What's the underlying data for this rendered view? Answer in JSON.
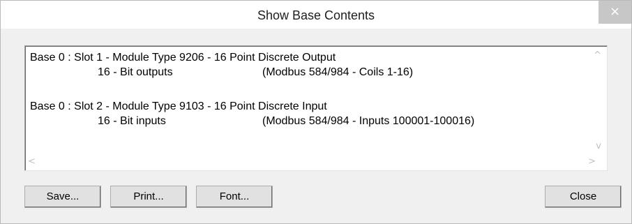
{
  "window": {
    "title": "Show Base Contents",
    "close_glyph": "×"
  },
  "content": {
    "entries": [
      {
        "header": "Base 0 : Slot 1 - Module Type 9206 - 16 Point Discrete Output",
        "detail": "16 - Bit outputs",
        "mapping": "(Modbus 584/984 - Coils 1-16)"
      },
      {
        "header": "Base 0 : Slot 2 - Module Type 9103 - 16 Point Discrete Input",
        "detail": "16 - Bit inputs",
        "mapping": "(Modbus 584/984 - Inputs 100001-100016)"
      }
    ],
    "scroll_up_glyph": "^",
    "scroll_down_glyph": "v",
    "scroll_left_glyph": "<",
    "scroll_right_glyph": ">"
  },
  "buttons": {
    "save": "Save...",
    "print": "Print...",
    "font": "Font...",
    "close": "Close"
  }
}
